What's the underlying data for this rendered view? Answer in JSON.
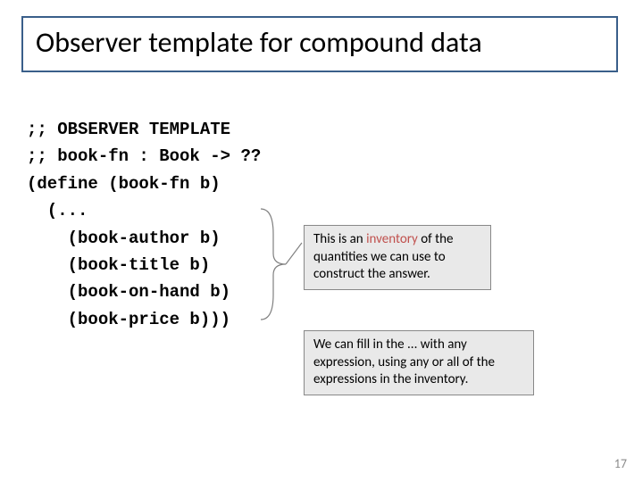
{
  "title": "Observer template for compound data",
  "code": {
    "l1": ";; OBSERVER TEMPLATE",
    "l2": ";; book-fn : Book -> ??",
    "l3": "(define (book-fn b)",
    "l4": "  (...",
    "l5": "    (book-author b)",
    "l6": "    (book-title b)",
    "l7": "    (book-on-hand b)",
    "l8": "    (book-price b)))"
  },
  "note1_pre": "This is an ",
  "note1_hl": "inventory",
  "note1_post": " of the quantities we can use to construct the answer.",
  "note2": "We can fill in the ... with any expression, using any or all of the expressions in the inventory.",
  "page": "17"
}
